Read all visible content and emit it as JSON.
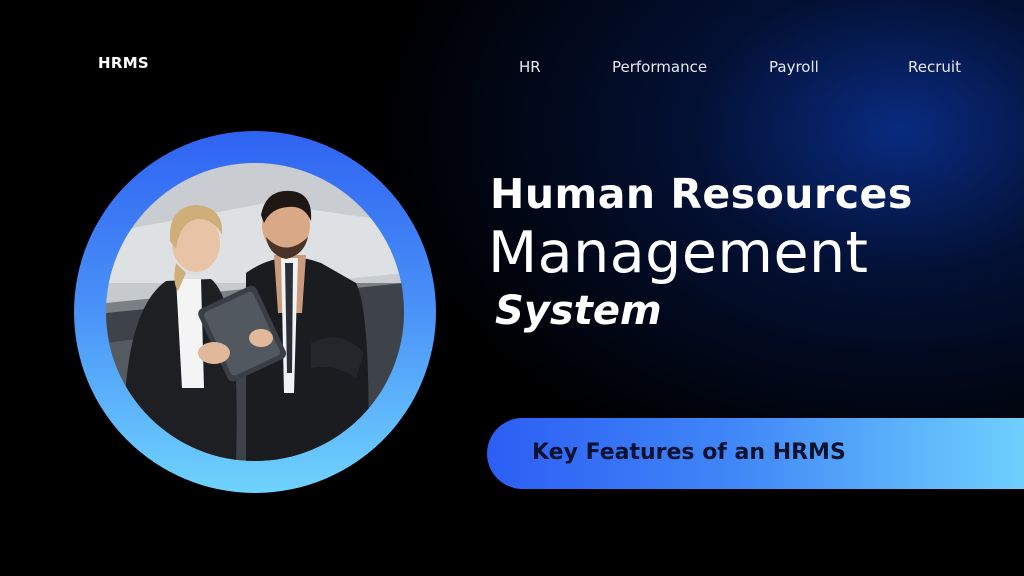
{
  "header": {
    "logo": "HRMS",
    "nav": [
      "HR",
      "Performance",
      "Payroll",
      "Recruit"
    ]
  },
  "hero": {
    "title_line1": "Human Resources",
    "title_line2": "Management",
    "title_line3": "System",
    "cta_label": "Key Features of an HRMS"
  },
  "colors": {
    "background": "#000000",
    "accent_blue": "#2f63f2",
    "accent_cyan": "#6fd3fd",
    "text": "#ffffff"
  },
  "image": {
    "subject": "two-business-people-with-tablet-photo"
  }
}
